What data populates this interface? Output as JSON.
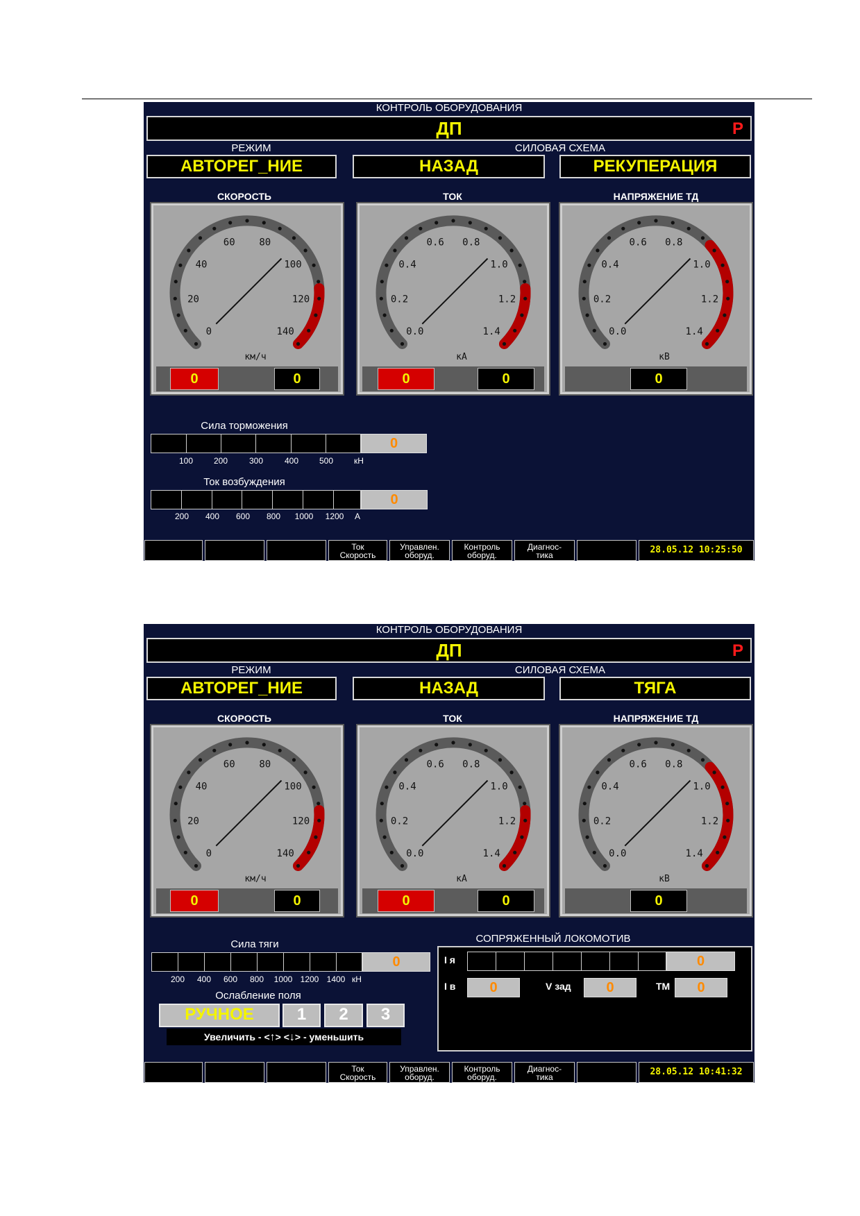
{
  "screens": [
    {
      "title": "КОНТРОЛЬ ОБОРУДОВАНИЯ",
      "banner": "ДП",
      "banner_flag": "Р",
      "mode_label": "РЕЖИМ",
      "mode_value": "АВТОРЕГ_НИЕ",
      "power_label": "СИЛОВАЯ СХЕМА",
      "direction_value": "НАЗАД",
      "power_value": "РЕКУПЕРАЦИЯ",
      "gauges": [
        {
          "label": "СКОРОСТЬ",
          "unit": "км/ч",
          "ticks": [
            "0",
            "20",
            "40",
            "60",
            "80",
            "100",
            "120",
            "140"
          ],
          "min": 0,
          "max": 140,
          "value": 0,
          "readouts": [
            "0",
            "0"
          ]
        },
        {
          "label": "ТОК",
          "unit": "кА",
          "ticks": [
            "0.0",
            "0.2",
            "0.4",
            "0.6",
            "0.8",
            "1.0",
            "1.2",
            "1.4"
          ],
          "min": 0,
          "max": 1.4,
          "value": 0,
          "readouts": [
            "0",
            "0"
          ]
        },
        {
          "label": "НАПРЯЖЕНИЕ ТД",
          "unit": "кВ",
          "ticks": [
            "0.0",
            "0.2",
            "0.4",
            "0.6",
            "0.8",
            "1.0",
            "1.2",
            "1.4"
          ],
          "min": 0,
          "max": 1.4,
          "value": 0,
          "readouts": [
            "0"
          ]
        }
      ],
      "meter1": {
        "label": "Сила торможения",
        "value": "0",
        "scale": [
          "100",
          "200",
          "300",
          "400",
          "500",
          "кН"
        ]
      },
      "meter2": {
        "label": "Ток возбуждения",
        "value": "0",
        "scale": [
          "200",
          "400",
          "600",
          "800",
          "1000",
          "1200",
          "А"
        ]
      },
      "footer": [
        "",
        "",
        "",
        "Ток\nСкорость",
        "Управлен.\nоборуд.",
        "Контроль\nоборуд.",
        "Диагнос-\nтика",
        ""
      ],
      "clock": "28.05.12  10:25:50"
    },
    {
      "title": "КОНТРОЛЬ ОБОРУДОВАНИЯ",
      "banner": "ДП",
      "banner_flag": "Р",
      "mode_label": "РЕЖИМ",
      "mode_value": "АВТОРЕГ_НИЕ",
      "power_label": "СИЛОВАЯ СХЕМА",
      "direction_value": "НАЗАД",
      "power_value": "ТЯГА",
      "gauges": [
        {
          "label": "СКОРОСТЬ",
          "unit": "км/ч",
          "ticks": [
            "0",
            "20",
            "40",
            "60",
            "80",
            "100",
            "120",
            "140"
          ],
          "min": 0,
          "max": 140,
          "value": 0,
          "readouts": [
            "0",
            "0"
          ]
        },
        {
          "label": "ТОК",
          "unit": "кА",
          "ticks": [
            "0.0",
            "0.2",
            "0.4",
            "0.6",
            "0.8",
            "1.0",
            "1.2",
            "1.4"
          ],
          "min": 0,
          "max": 1.4,
          "value": 0,
          "readouts": [
            "0",
            "0"
          ]
        },
        {
          "label": "НАПРЯЖЕНИЕ ТД",
          "unit": "кВ",
          "ticks": [
            "0.0",
            "0.2",
            "0.4",
            "0.6",
            "0.8",
            "1.0",
            "1.2",
            "1.4"
          ],
          "min": 0,
          "max": 1.4,
          "value": 0,
          "readouts": [
            "0"
          ]
        }
      ],
      "traction": {
        "label": "Сила тяги",
        "value": "0",
        "scale": [
          "200",
          "400",
          "600",
          "800",
          "1000",
          "1200",
          "1400",
          "кН"
        ]
      },
      "field": {
        "label": "Ослабление поля",
        "mode": "РУЧНОЕ",
        "steps": [
          "1",
          "2",
          "3"
        ],
        "hint_prefix": "Увеличить - <",
        "hint_mid": "> <",
        "hint_suffix": "> - уменьшить"
      },
      "coupled": {
        "label": "СОПРЯЖЕННЫЙ ЛОКОМОТИВ",
        "ia_label": "I я",
        "ia_value": "0",
        "iv_label": "I в",
        "iv_value": "0",
        "vz_label": "V зад",
        "vz_value": "0",
        "tm_label": "ТМ",
        "tm_value": "0"
      },
      "footer": [
        "",
        "",
        "",
        "Ток\nСкорость",
        "Управлен.\nоборуд.",
        "Контроль\nоборуд.",
        "Диагнос-\nтика",
        ""
      ],
      "clock": "28.05.12  10:41:32"
    }
  ]
}
